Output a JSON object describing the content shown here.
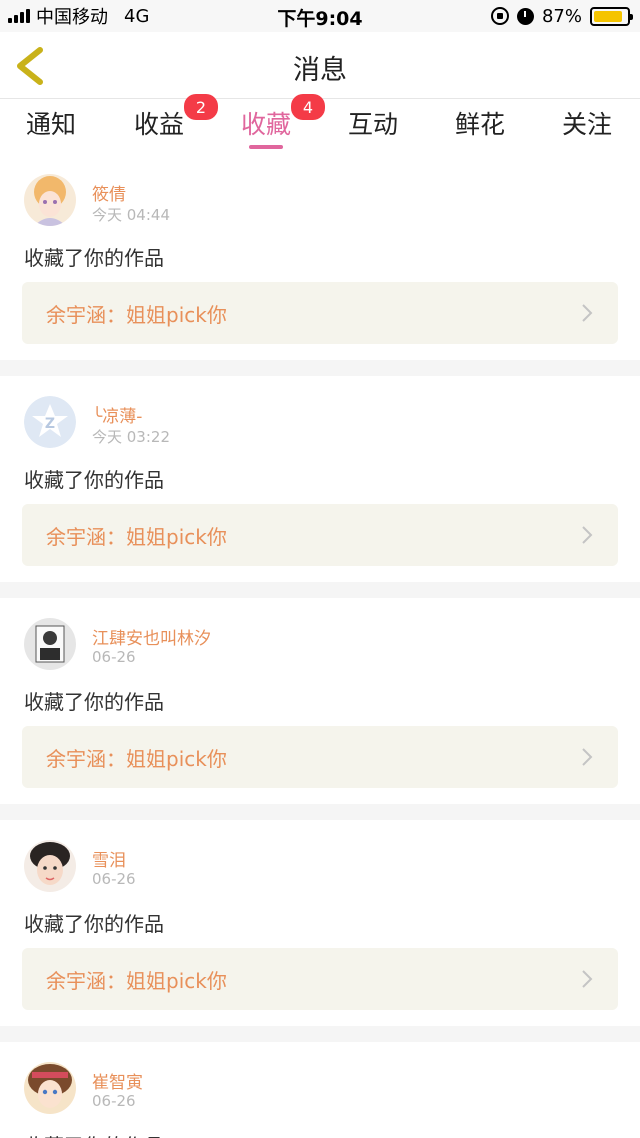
{
  "status_bar": {
    "carrier": "中国移动",
    "network": "4G",
    "time": "下午9:04",
    "battery": "87%"
  },
  "header": {
    "title": "消息"
  },
  "tabs": [
    {
      "label": "通知",
      "badge": ""
    },
    {
      "label": "收益",
      "badge": "2"
    },
    {
      "label": "收藏",
      "badge": "4",
      "active": true
    },
    {
      "label": "互动",
      "badge": ""
    },
    {
      "label": "鲜花",
      "badge": ""
    },
    {
      "label": "关注",
      "badge": ""
    }
  ],
  "messages": [
    {
      "user": "筱倩",
      "time": "今天 04:44",
      "action": "收藏了你的作品",
      "work": "余宇涵：姐姐pick你"
    },
    {
      "user": "╰凉薄-",
      "time": "今天 03:22",
      "action": "收藏了你的作品",
      "work": "余宇涵：姐姐pick你"
    },
    {
      "user": "江肆安也叫林汐",
      "time": "06-26",
      "action": "收藏了你的作品",
      "work": "余宇涵：姐姐pick你"
    },
    {
      "user": "雪泪",
      "time": "06-26",
      "action": "收藏了你的作品",
      "work": "余宇涵：姐姐pick你"
    },
    {
      "user": "崔智寅",
      "time": "06-26",
      "action": "收藏了你的作品",
      "work": ""
    }
  ],
  "colors": {
    "accent": "#e0669d",
    "badge": "#f43b47",
    "username": "#e8905a",
    "work_bg": "#f5f4ec"
  }
}
